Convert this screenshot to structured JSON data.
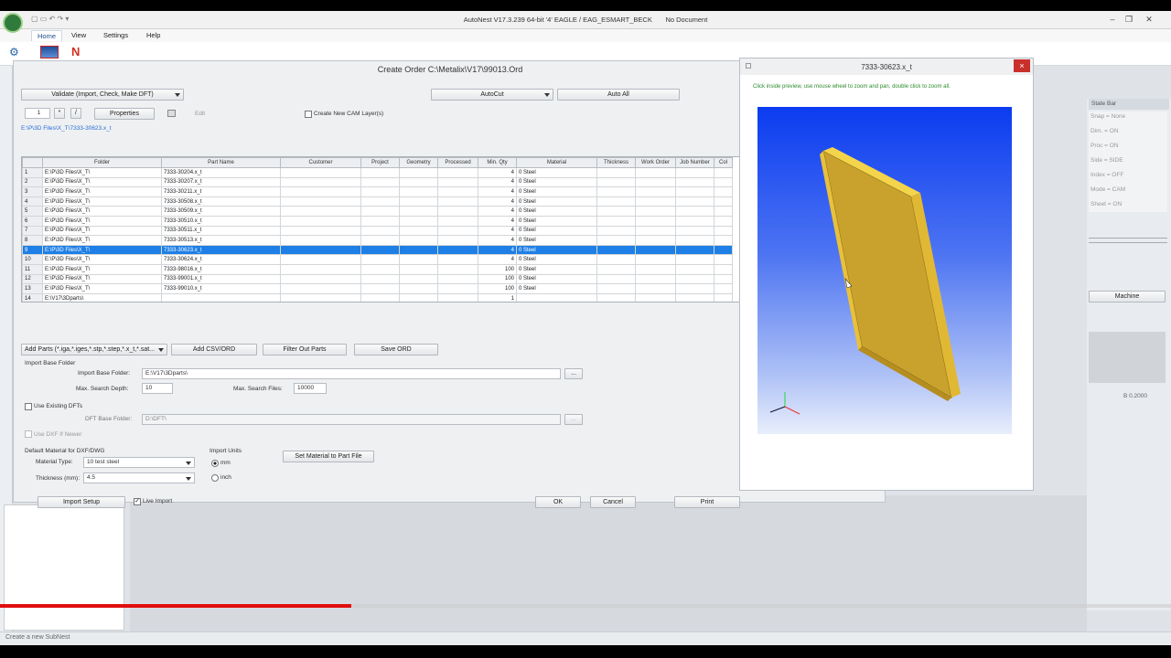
{
  "window": {
    "title": "AutoNest V17.3.239 64-bit '4' EAGLE / EAG_ESMART_BECK",
    "document": "No Document"
  },
  "menu": [
    "Home",
    "View",
    "Settings",
    "Help"
  ],
  "dialog": {
    "title": "Create Order C:\\Metalix\\V17\\99013.Ord",
    "validate_label": "Validate (Import, Check, Make DFT)",
    "autocut_label": "AutoCut",
    "autoall_label": "Auto All",
    "index_value": "1",
    "properties_label": "Properties",
    "edit_label": "Edit",
    "cam_layers_label": "Create New CAM Layer(s)",
    "path_label": "E:\\P\\3D Files\\X_T\\7333-30623.x_t",
    "columns": [
      "",
      "Folder",
      "Part Name",
      "Customer",
      "Project",
      "Geometry",
      "Processed",
      "Min. Qty",
      "Material",
      "Thickness",
      "Work Order",
      "Job Number",
      "Col"
    ],
    "rows": [
      {
        "n": "1",
        "folder": "E:\\P\\3D Files\\X_T\\",
        "part": "7333-30204.x_t",
        "qty": "4",
        "mat": "0 Steel"
      },
      {
        "n": "2",
        "folder": "E:\\P\\3D Files\\X_T\\",
        "part": "7333-30207.x_t",
        "qty": "4",
        "mat": "0 Steel"
      },
      {
        "n": "3",
        "folder": "E:\\P\\3D Files\\X_T\\",
        "part": "7333-30211.x_t",
        "qty": "4",
        "mat": "0 Steel"
      },
      {
        "n": "4",
        "folder": "E:\\P\\3D Files\\X_T\\",
        "part": "7333-30508.x_t",
        "qty": "4",
        "mat": "0 Steel"
      },
      {
        "n": "5",
        "folder": "E:\\P\\3D Files\\X_T\\",
        "part": "7333-30509.x_t",
        "qty": "4",
        "mat": "0 Steel"
      },
      {
        "n": "6",
        "folder": "E:\\P\\3D Files\\X_T\\",
        "part": "7333-30510.x_t",
        "qty": "4",
        "mat": "0 Steel"
      },
      {
        "n": "7",
        "folder": "E:\\P\\3D Files\\X_T\\",
        "part": "7333-30511.x_t",
        "qty": "4",
        "mat": "0 Steel"
      },
      {
        "n": "8",
        "folder": "E:\\P\\3D Files\\X_T\\",
        "part": "7333-30513.x_t",
        "qty": "4",
        "mat": "0 Steel"
      },
      {
        "n": "9",
        "folder": "E:\\P\\3D Files\\X_T\\",
        "part": "7333-30623.x_t",
        "qty": "4",
        "mat": "0 Steel",
        "selected": true
      },
      {
        "n": "10",
        "folder": "E:\\P\\3D Files\\X_T\\",
        "part": "7333-30624.x_t",
        "qty": "4",
        "mat": "0 Steel"
      },
      {
        "n": "11",
        "folder": "E:\\P\\3D Files\\X_T\\",
        "part": "7333-98016.x_t",
        "qty": "100",
        "mat": "0 Steel"
      },
      {
        "n": "12",
        "folder": "E:\\P\\3D Files\\X_T\\",
        "part": "7333-99001.x_t",
        "qty": "100",
        "mat": "0 Steel"
      },
      {
        "n": "13",
        "folder": "E:\\P\\3D Files\\X_T\\",
        "part": "7333-99010.x_t",
        "qty": "100",
        "mat": "0 Steel"
      },
      {
        "n": "14",
        "folder": "E:\\V17\\3Dparts\\",
        "part": "",
        "qty": "1",
        "mat": ""
      }
    ],
    "add_parts_label": "Add Parts (*.iga,*.iges,*.stp,*.step,*.x_t,*.sat...",
    "add_csv_label": "Add CSV/ORD",
    "filter_label": "Filter Out Parts",
    "save_ord_label": "Save ORD",
    "import_base_group": "Import Base Folder",
    "import_base_label": "Import Base Folder:",
    "import_base_value": "E:\\V17\\3Dparts\\",
    "browse_label": "...",
    "max_depth_label": "Max. Search Depth:",
    "max_depth_value": "10",
    "max_files_label": "Max. Search Files:",
    "max_files_value": "10000",
    "use_existing_dfts": "Use Existing DFTs",
    "dft_base_label": "DFT Base Folder:",
    "dft_base_value": "D:\\DFT\\",
    "use_dxf_newer": "Use DXF If Newer",
    "default_material_group": "Default Material for DXF/DWG",
    "material_type_label": "Material Type:",
    "material_type_value": "10   test steel",
    "thickness_label": "Thickness (mm):",
    "thickness_value": "4.5",
    "import_units_label": "Import Units",
    "unit_mm": "mm",
    "unit_inch": "inch",
    "set_material_label": "Set Material to Part File",
    "import_setup_label": "Import Setup",
    "live_import_label": "Live Import",
    "ok_label": "OK",
    "cancel_label": "Cancel",
    "print_label": "Print"
  },
  "preview": {
    "title": "7333-30623.x_t",
    "hint": "Click inside preview, use mouse wheel to zoom and pan, double click to zoom all.",
    "close_label": "×"
  },
  "state_bar": {
    "title": "State Bar",
    "items": [
      "Snap = None",
      "Dim. = ON",
      "Proc = ON",
      "Side = SIDE",
      "Index = OFF",
      "Mode = CAM",
      "Sheet = ON"
    ],
    "machine_label": "Machine",
    "value_label": "B 0.2000"
  },
  "status": {
    "text": "Create a new SubNest"
  },
  "video_progress": 0.3,
  "colors": {
    "selection": "#1e7fe6",
    "viewport_top": "#0b3cf0",
    "part_face": "#c9a22e",
    "progress_played": "#e10d0d"
  }
}
